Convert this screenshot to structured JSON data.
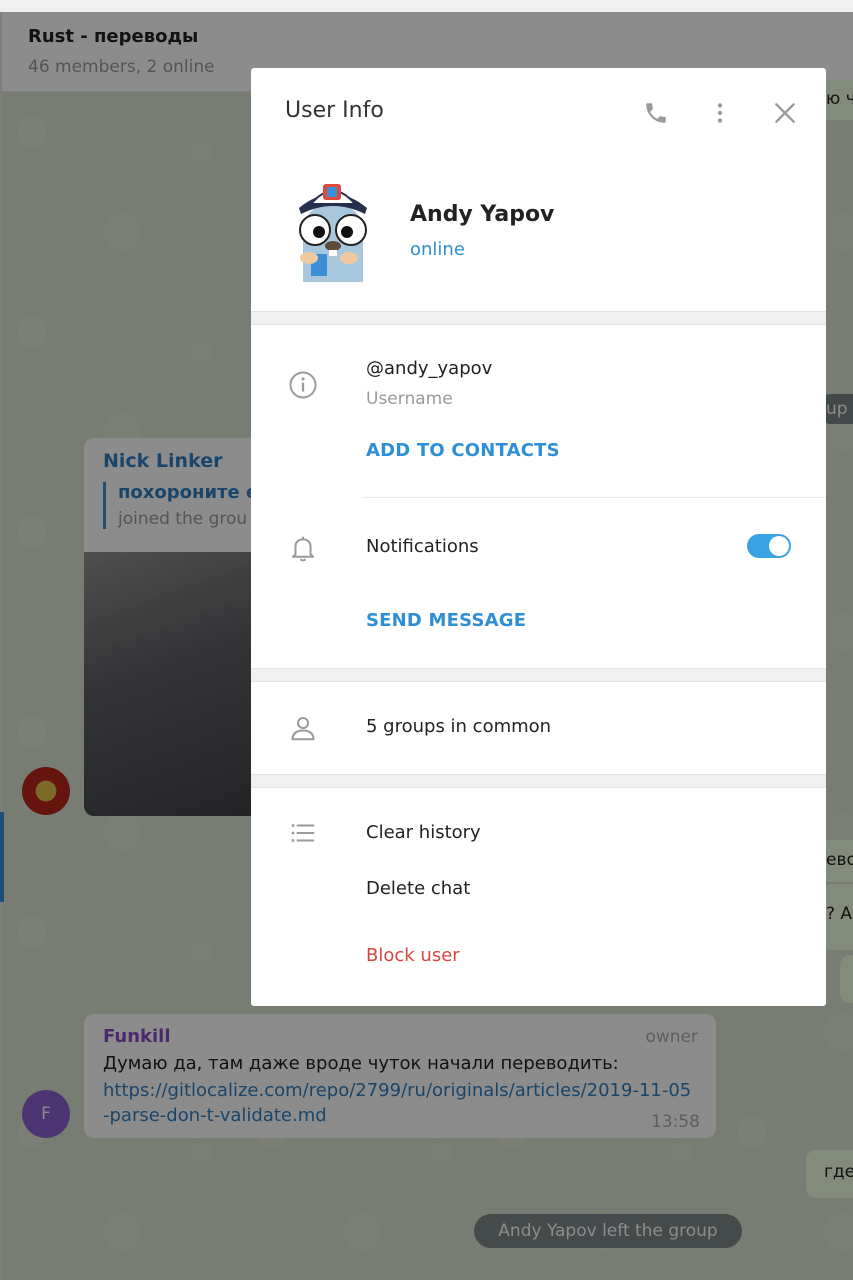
{
  "chat": {
    "title": "Rust - переводы",
    "subtitle": "46 members, 2 online",
    "messages": {
      "nick": {
        "author": "Nick Linker",
        "reply_title": "похороните ес",
        "reply_sub": "joined the grou"
      },
      "funkill": {
        "author": "Funkill",
        "badge": "owner",
        "text": "Думаю да, там даже вроде чуток начали переводить:",
        "link": "https://gitlocalize.com/repo/2799/ru/originals/articles/2019-11-05-parse-don-t-validate.md",
        "time": "13:58",
        "avatar_letter": "F"
      },
      "right_fragments": {
        "top": "ю ч",
        "ups": "up",
        "evo": "ево",
        "qa": "? А",
        "gde": "где"
      },
      "service": "Andy Yapov left the group"
    }
  },
  "modal": {
    "title": "User Info",
    "icons": {
      "call": "phone-icon",
      "more": "more-vertical-icon",
      "close": "close-icon"
    },
    "user": {
      "name": "Andy Yapov",
      "status": "online",
      "username": "@andy_yapov",
      "username_label": "Username"
    },
    "actions": {
      "add_contacts": "ADD TO CONTACTS",
      "notifications": "Notifications",
      "notifications_on": true,
      "send_message": "SEND MESSAGE",
      "groups_in_common": "5 groups in common",
      "clear_history": "Clear history",
      "delete_chat": "Delete chat",
      "block_user": "Block user"
    },
    "colors": {
      "accent": "#2f8fd6",
      "danger": "#d9463f",
      "toggle": "#3aa3e3"
    }
  }
}
